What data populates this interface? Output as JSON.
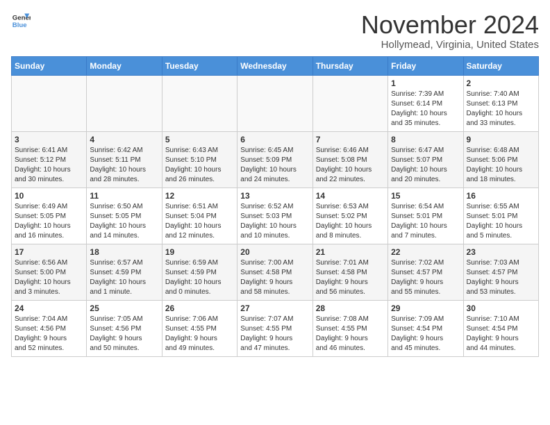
{
  "logo": {
    "line1": "General",
    "line2": "Blue"
  },
  "title": "November 2024",
  "subtitle": "Hollymead, Virginia, United States",
  "weekdays": [
    "Sunday",
    "Monday",
    "Tuesday",
    "Wednesday",
    "Thursday",
    "Friday",
    "Saturday"
  ],
  "weeks": [
    [
      {
        "day": "",
        "info": ""
      },
      {
        "day": "",
        "info": ""
      },
      {
        "day": "",
        "info": ""
      },
      {
        "day": "",
        "info": ""
      },
      {
        "day": "",
        "info": ""
      },
      {
        "day": "1",
        "info": "Sunrise: 7:39 AM\nSunset: 6:14 PM\nDaylight: 10 hours\nand 35 minutes."
      },
      {
        "day": "2",
        "info": "Sunrise: 7:40 AM\nSunset: 6:13 PM\nDaylight: 10 hours\nand 33 minutes."
      }
    ],
    [
      {
        "day": "3",
        "info": "Sunrise: 6:41 AM\nSunset: 5:12 PM\nDaylight: 10 hours\nand 30 minutes."
      },
      {
        "day": "4",
        "info": "Sunrise: 6:42 AM\nSunset: 5:11 PM\nDaylight: 10 hours\nand 28 minutes."
      },
      {
        "day": "5",
        "info": "Sunrise: 6:43 AM\nSunset: 5:10 PM\nDaylight: 10 hours\nand 26 minutes."
      },
      {
        "day": "6",
        "info": "Sunrise: 6:45 AM\nSunset: 5:09 PM\nDaylight: 10 hours\nand 24 minutes."
      },
      {
        "day": "7",
        "info": "Sunrise: 6:46 AM\nSunset: 5:08 PM\nDaylight: 10 hours\nand 22 minutes."
      },
      {
        "day": "8",
        "info": "Sunrise: 6:47 AM\nSunset: 5:07 PM\nDaylight: 10 hours\nand 20 minutes."
      },
      {
        "day": "9",
        "info": "Sunrise: 6:48 AM\nSunset: 5:06 PM\nDaylight: 10 hours\nand 18 minutes."
      }
    ],
    [
      {
        "day": "10",
        "info": "Sunrise: 6:49 AM\nSunset: 5:05 PM\nDaylight: 10 hours\nand 16 minutes."
      },
      {
        "day": "11",
        "info": "Sunrise: 6:50 AM\nSunset: 5:05 PM\nDaylight: 10 hours\nand 14 minutes."
      },
      {
        "day": "12",
        "info": "Sunrise: 6:51 AM\nSunset: 5:04 PM\nDaylight: 10 hours\nand 12 minutes."
      },
      {
        "day": "13",
        "info": "Sunrise: 6:52 AM\nSunset: 5:03 PM\nDaylight: 10 hours\nand 10 minutes."
      },
      {
        "day": "14",
        "info": "Sunrise: 6:53 AM\nSunset: 5:02 PM\nDaylight: 10 hours\nand 8 minutes."
      },
      {
        "day": "15",
        "info": "Sunrise: 6:54 AM\nSunset: 5:01 PM\nDaylight: 10 hours\nand 7 minutes."
      },
      {
        "day": "16",
        "info": "Sunrise: 6:55 AM\nSunset: 5:01 PM\nDaylight: 10 hours\nand 5 minutes."
      }
    ],
    [
      {
        "day": "17",
        "info": "Sunrise: 6:56 AM\nSunset: 5:00 PM\nDaylight: 10 hours\nand 3 minutes."
      },
      {
        "day": "18",
        "info": "Sunrise: 6:57 AM\nSunset: 4:59 PM\nDaylight: 10 hours\nand 1 minute."
      },
      {
        "day": "19",
        "info": "Sunrise: 6:59 AM\nSunset: 4:59 PM\nDaylight: 10 hours\nand 0 minutes."
      },
      {
        "day": "20",
        "info": "Sunrise: 7:00 AM\nSunset: 4:58 PM\nDaylight: 9 hours\nand 58 minutes."
      },
      {
        "day": "21",
        "info": "Sunrise: 7:01 AM\nSunset: 4:58 PM\nDaylight: 9 hours\nand 56 minutes."
      },
      {
        "day": "22",
        "info": "Sunrise: 7:02 AM\nSunset: 4:57 PM\nDaylight: 9 hours\nand 55 minutes."
      },
      {
        "day": "23",
        "info": "Sunrise: 7:03 AM\nSunset: 4:57 PM\nDaylight: 9 hours\nand 53 minutes."
      }
    ],
    [
      {
        "day": "24",
        "info": "Sunrise: 7:04 AM\nSunset: 4:56 PM\nDaylight: 9 hours\nand 52 minutes."
      },
      {
        "day": "25",
        "info": "Sunrise: 7:05 AM\nSunset: 4:56 PM\nDaylight: 9 hours\nand 50 minutes."
      },
      {
        "day": "26",
        "info": "Sunrise: 7:06 AM\nSunset: 4:55 PM\nDaylight: 9 hours\nand 49 minutes."
      },
      {
        "day": "27",
        "info": "Sunrise: 7:07 AM\nSunset: 4:55 PM\nDaylight: 9 hours\nand 47 minutes."
      },
      {
        "day": "28",
        "info": "Sunrise: 7:08 AM\nSunset: 4:55 PM\nDaylight: 9 hours\nand 46 minutes."
      },
      {
        "day": "29",
        "info": "Sunrise: 7:09 AM\nSunset: 4:54 PM\nDaylight: 9 hours\nand 45 minutes."
      },
      {
        "day": "30",
        "info": "Sunrise: 7:10 AM\nSunset: 4:54 PM\nDaylight: 9 hours\nand 44 minutes."
      }
    ]
  ]
}
